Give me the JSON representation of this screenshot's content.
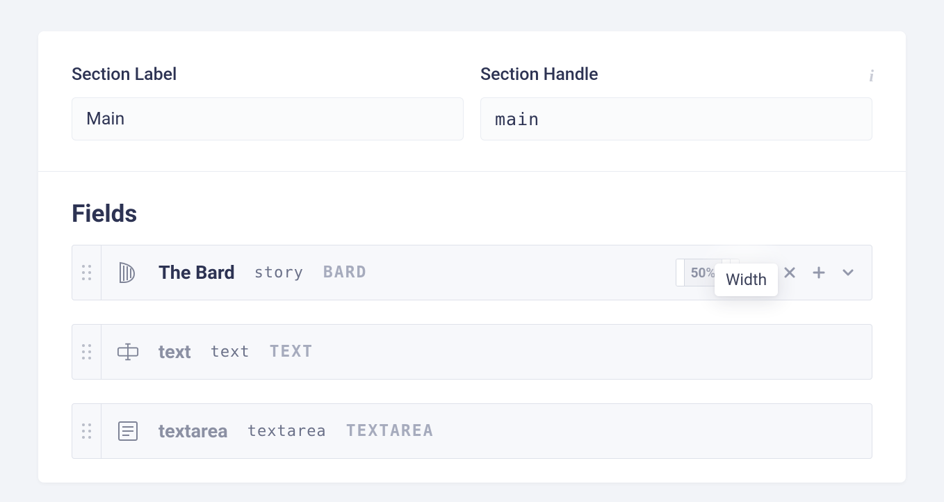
{
  "section": {
    "label_caption": "Section Label",
    "label_value": "Main",
    "handle_caption": "Section Handle",
    "handle_value": "main"
  },
  "fields_heading": "Fields",
  "tooltip": "Width",
  "fields": [
    {
      "title": "The Bard",
      "handle": "story",
      "type": "BARD",
      "width": "50%",
      "active": true
    },
    {
      "title": "text",
      "handle": "text",
      "type": "TEXT",
      "width": null,
      "active": false
    },
    {
      "title": "textarea",
      "handle": "textarea",
      "type": "TEXTAREA",
      "width": null,
      "active": false
    }
  ]
}
